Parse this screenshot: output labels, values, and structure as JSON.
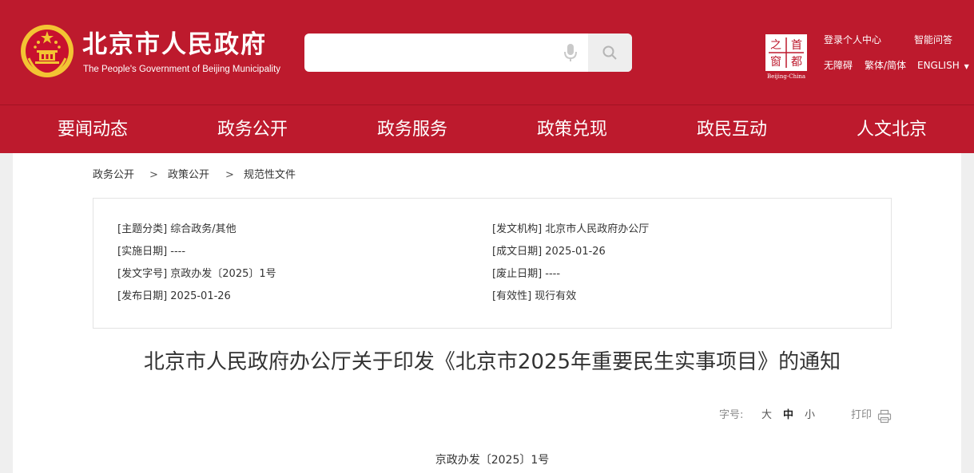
{
  "header": {
    "site_name": "北京市人民政府",
    "site_name_en": "The People's Government of Beijing Municipality",
    "search_placeholder": "",
    "window_logo_chars": [
      "之",
      "首",
      "都",
      "窗"
    ],
    "window_logo_caption": "Beijing-China",
    "links": {
      "login": "登录个人中心",
      "smart_qa": "智能问答",
      "accessibility": "无障碍",
      "traditional_simplified": "繁体/简体",
      "english": "ENGLISH"
    }
  },
  "nav": [
    "要闻动态",
    "政务公开",
    "政务服务",
    "政策兑现",
    "政民互动",
    "人文北京"
  ],
  "breadcrumb": [
    "政务公开",
    "政策公开",
    "规范性文件"
  ],
  "breadcrumb_sep": ">",
  "meta": {
    "topic": "[主题分类] 综合政务/其他",
    "issuer": "[发文机构] 北京市人民政府办公厅",
    "effective_date": "[实施日期] ----",
    "written_date": "[成文日期] 2025-01-26",
    "doc_number": "[发文字号] 京政办发〔2025〕1号",
    "repeal_date": "[废止日期] ----",
    "publish_date": "[发布日期] 2025-01-26",
    "validity": "[有效性] 现行有效"
  },
  "title": "北京市人民政府办公厅关于印发《北京市2025年重要民生实事项目》的通知",
  "tools": {
    "font_label": "字号:",
    "sizes": [
      "大",
      "中",
      "小"
    ],
    "active_size": "中",
    "print": "打印"
  },
  "doc_no": "京政办发〔2025〕1号",
  "colors": {
    "brand_red": "#bd1a2d",
    "gold": "#f3c433"
  },
  "icons": [
    "national-emblem-icon",
    "microphone-icon",
    "search-icon",
    "window-logo-icon",
    "caret-down-icon",
    "printer-icon"
  ]
}
